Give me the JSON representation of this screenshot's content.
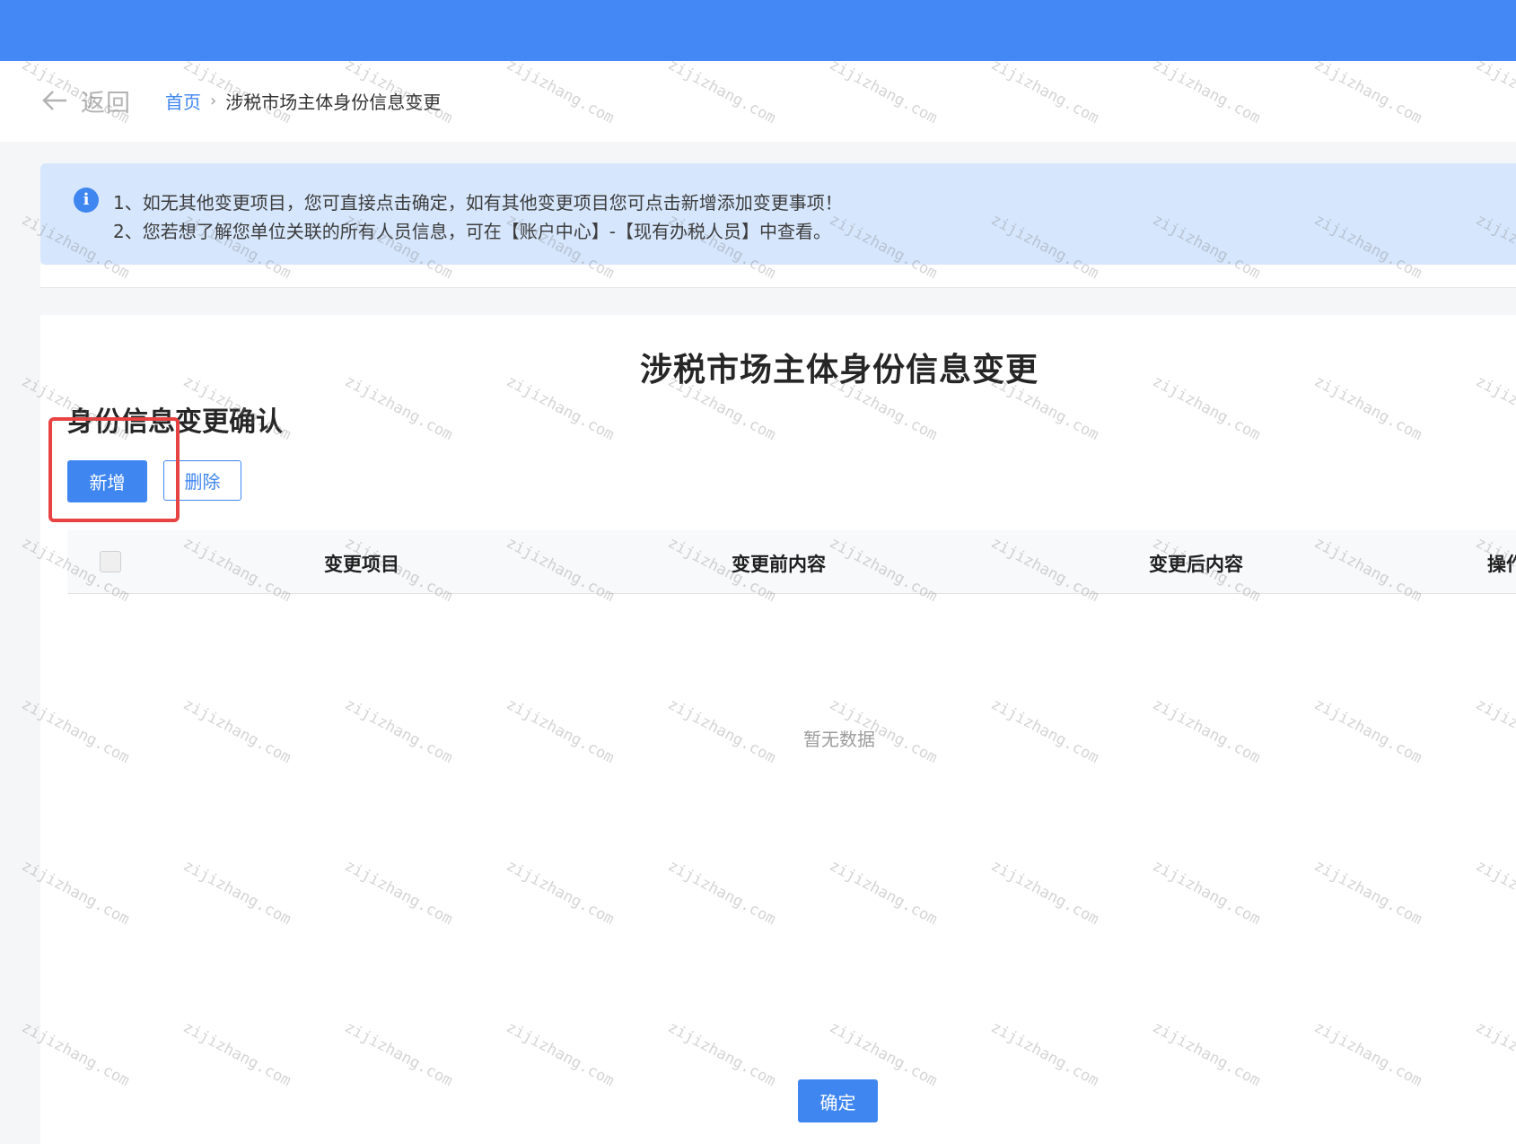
{
  "nav": {
    "back_label": "返回",
    "breadcrumb_home": "首页",
    "breadcrumb_separator": "›",
    "breadcrumb_current": "涉税市场主体身份信息变更"
  },
  "notice": {
    "icon": "info-icon",
    "line1": "1、如无其他变更项目，您可直接点击确定，如有其他变更项目您可点击新增添加变更事项！",
    "line2": "2、您若想了解您单位关联的所有人员信息，可在【账户中心】-【现有办税人员】中查看。"
  },
  "main": {
    "page_title": "涉税市场主体身份信息变更",
    "section_title": "身份信息变更确认",
    "add_button": "新增",
    "delete_button": "删除",
    "table": {
      "columns": [
        "变更项目",
        "变更前内容",
        "变更后内容",
        "操作"
      ],
      "rows": [],
      "empty_text": "暂无数据"
    },
    "confirm_button": "确定"
  },
  "watermark": {
    "text": "zijizhang.com"
  },
  "colors": {
    "topbar": "#4488f5",
    "primary": "#3f86f1",
    "notice_bg": "#d6e6fc",
    "highlight": "#e84343"
  }
}
